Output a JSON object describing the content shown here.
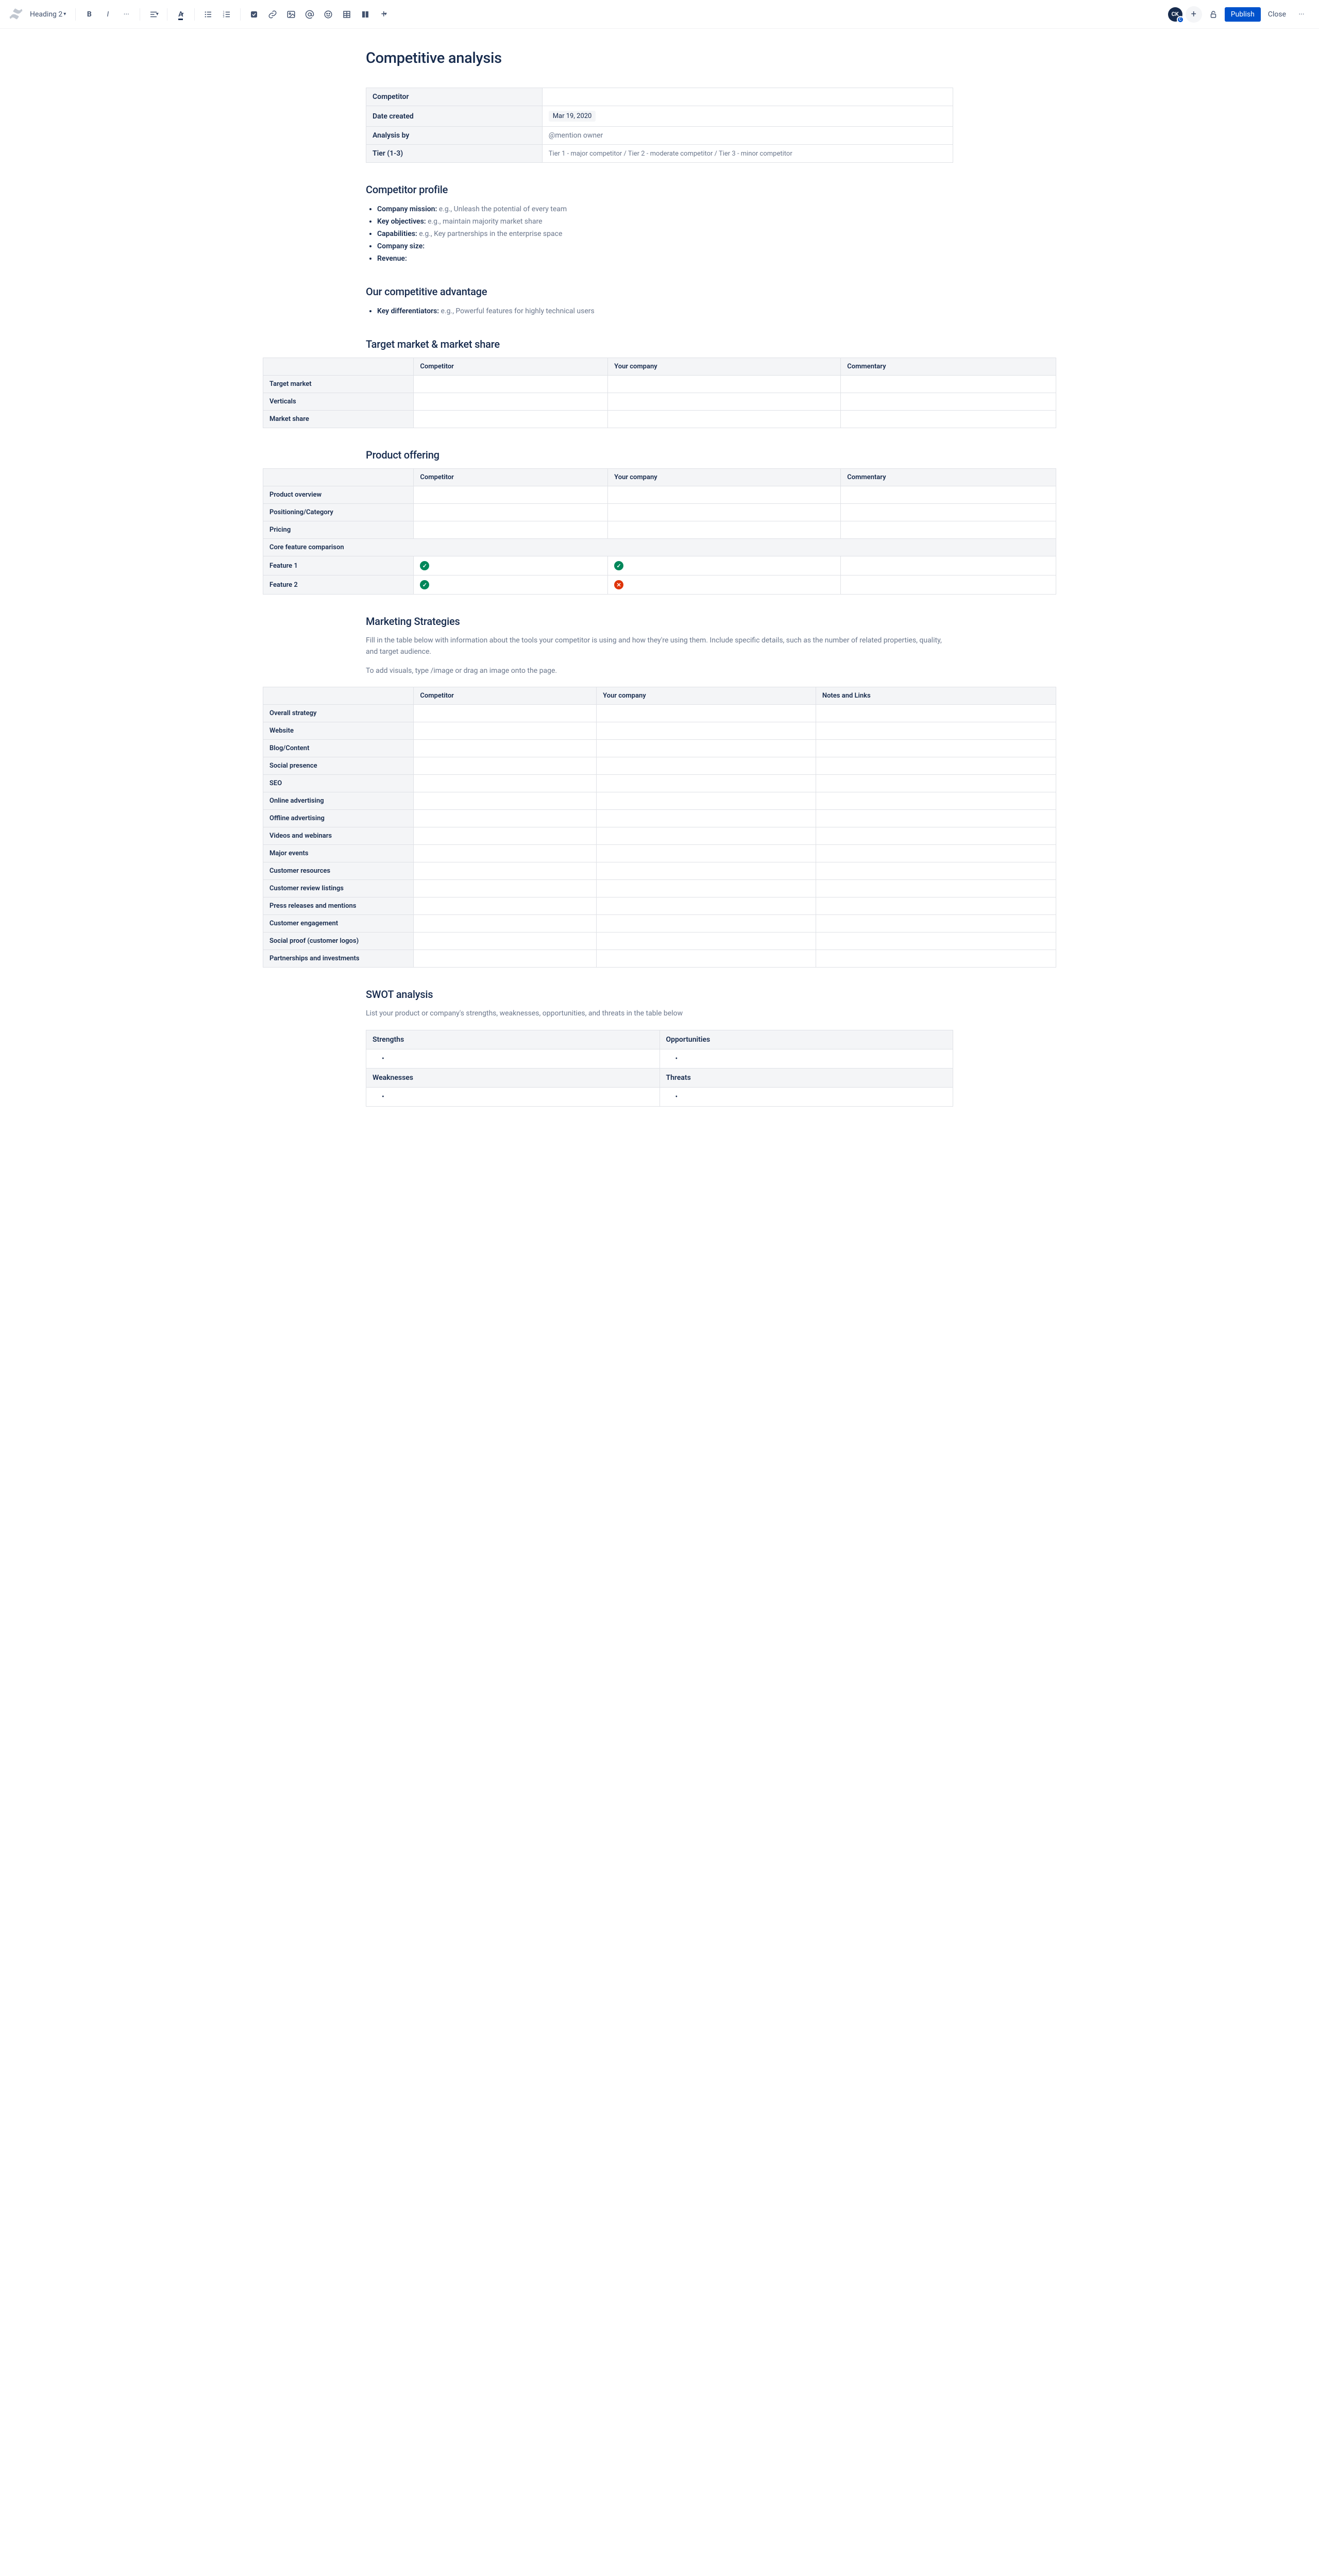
{
  "toolbar": {
    "text_style": "Heading 2",
    "avatar_initials": "CK",
    "avatar_badge": "C",
    "publish_label": "Publish",
    "close_label": "Close"
  },
  "page": {
    "title": "Competitive analysis"
  },
  "meta": {
    "rows": [
      {
        "label": "Competitor",
        "value": "",
        "type": "text"
      },
      {
        "label": "Date created",
        "value": "Mar 19, 2020",
        "type": "date"
      },
      {
        "label": "Analysis by",
        "value": "@mention owner",
        "type": "mention"
      },
      {
        "label": "Tier (1-3)",
        "value": "Tier 1 - major competitor / Tier 2 - moderate competitor / Tier 3 - minor competitor",
        "type": "tier"
      }
    ]
  },
  "profile": {
    "heading": "Competitor profile",
    "items": [
      {
        "label": "Company mission:",
        "hint": " e.g., Unleash the potential of every team"
      },
      {
        "label": "Key objectives:",
        "hint": " e.g., maintain majority market share"
      },
      {
        "label": "Capabilities:",
        "hint": " e.g., Key partnerships in the enterprise space"
      },
      {
        "label": "Company size:",
        "hint": ""
      },
      {
        "label": "Revenue:",
        "hint": ""
      }
    ]
  },
  "advantage": {
    "heading": "Our competitive advantage",
    "items": [
      {
        "label": "Key differentiators:",
        "hint": " e.g., Powerful features for highly technical users"
      }
    ]
  },
  "target_market": {
    "heading": "Target market & market share",
    "cols": [
      "",
      "Competitor",
      "Your company",
      "Commentary"
    ],
    "rows": [
      "Target market",
      "Verticals",
      "Market share"
    ]
  },
  "product": {
    "heading": "Product offering",
    "cols": [
      "",
      "Competitor",
      "Your company",
      "Commentary"
    ],
    "rows": [
      "Product overview",
      "Positioning/Category",
      "Pricing"
    ],
    "span_row": "Core feature comparison",
    "feature_rows": [
      {
        "label": "Feature 1",
        "comp": "green",
        "you": "green"
      },
      {
        "label": "Feature 2",
        "comp": "green",
        "you": "red"
      }
    ]
  },
  "marketing": {
    "heading": "Marketing Strategies",
    "desc1": "Fill in the table below with information about the tools your competitor is using and how they're using them. Include specific details, such as the number of related properties, quality, and target audience.",
    "desc2": "To add visuals, type /image or drag an image onto the page.",
    "cols": [
      "",
      "Competitor",
      "Your company",
      "Notes and Links"
    ],
    "rows": [
      "Overall strategy",
      "Website",
      "Blog/Content",
      "Social presence",
      "SEO",
      "Online advertising",
      "Offline advertising",
      "Videos and webinars",
      "Major events",
      "Customer resources",
      "Customer review listings",
      "Press releases and mentions",
      "Customer engagement",
      "Social proof (customer logos)",
      "Partnerships and investments"
    ]
  },
  "swot": {
    "heading": "SWOT analysis",
    "desc": "List your product or company's strengths, weaknesses, opportunities, and threats in the table below",
    "labels": {
      "s": "Strengths",
      "w": "Weaknesses",
      "o": "Opportunities",
      "t": "Threats"
    }
  }
}
